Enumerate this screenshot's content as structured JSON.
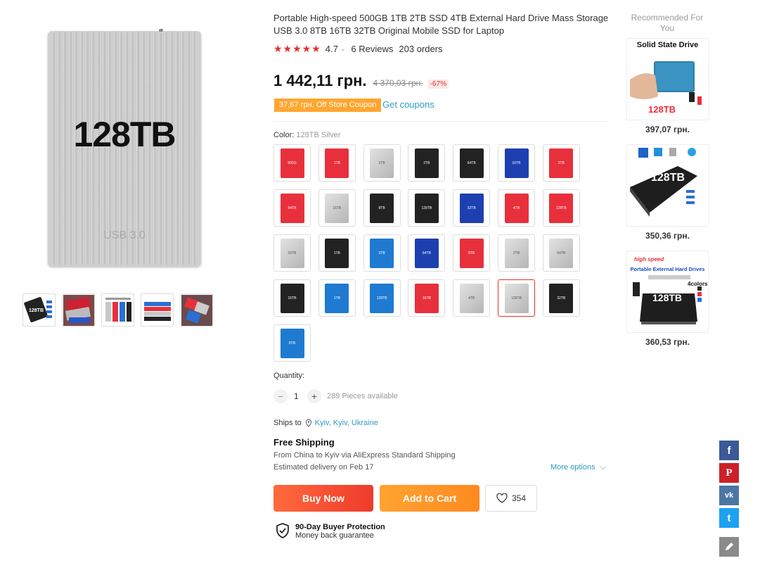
{
  "gallery": {
    "caption": "128TB",
    "usb_text": "USB 3.0",
    "thumb_labels": [
      "128TB"
    ]
  },
  "product": {
    "title": "Portable High-speed 500GB 1TB 2TB SSD 4TB External Hard Drive Mass Storage USB 3.0 8TB 16TB 32TB Original Mobile SSD for Laptop",
    "stars": "★★★★★",
    "rating": "4.7",
    "reviews": "6 Reviews",
    "orders": "203 orders",
    "price": "1 442,11 грн.",
    "old_price": "4 370,03 грн.",
    "discount": "-67%",
    "coupon": "37,67 грн. Off Store Coupon",
    "get_coupons": "Get coupons",
    "color_label": "Color:",
    "color_value": "128TB Silver",
    "swatches": [
      {
        "color": "#e8303c",
        "label": "500G"
      },
      {
        "color": "#e8303c",
        "label": "1TB"
      },
      {
        "color": "#c8c8c8",
        "label": "2TB"
      },
      {
        "color": "#222",
        "label": "2TB"
      },
      {
        "color": "#222",
        "label": "64TB"
      },
      {
        "color": "#1d3fb0",
        "label": "16TB"
      },
      {
        "color": "#e8303c",
        "label": "2TB"
      },
      {
        "color": "#e8303c",
        "label": "64TB"
      },
      {
        "color": "#c8c8c8",
        "label": "16TB"
      },
      {
        "color": "#222",
        "label": "8TB"
      },
      {
        "color": "#222",
        "label": "128TB"
      },
      {
        "color": "#1d3fb0",
        "label": "32TB"
      },
      {
        "color": "#e8303c",
        "label": "4TB"
      },
      {
        "color": "#e8303c",
        "label": "128TB"
      },
      {
        "color": "#c8c8c8",
        "label": "32TB"
      },
      {
        "color": "#222",
        "label": "1TB"
      },
      {
        "color": "#1f7ad1",
        "label": "2TB"
      },
      {
        "color": "#1d3fb0",
        "label": "64TB"
      },
      {
        "color": "#e8303c",
        "label": "8TB"
      },
      {
        "color": "#c8c8c8",
        "label": "2TB"
      },
      {
        "color": "#c8c8c8",
        "label": "64TB"
      },
      {
        "color": "#222",
        "label": "16TB"
      },
      {
        "color": "#1f7ad1",
        "label": "1TB"
      },
      {
        "color": "#1f7ad1",
        "label": "128TB"
      },
      {
        "color": "#e8303c",
        "label": "16TB"
      },
      {
        "color": "#c8c8c8",
        "label": "4TB"
      },
      {
        "color": "#c8c8c8",
        "label": "128TB",
        "selected": true
      },
      {
        "color": "#222",
        "label": "32TB"
      },
      {
        "color": "#1f7ad1",
        "label": "8TB"
      }
    ],
    "quantity_label": "Quantity:",
    "quantity": "1",
    "available": "289 Pieces available",
    "ships_to_label": "Ships to",
    "ships_to": "Kyiv, Kyiv, Ukraine",
    "free_shipping": "Free Shipping",
    "shipping_from": "From China to Kyiv via AliExpress Standard Shipping",
    "estimated": "Estimated delivery on Feb 17",
    "more_options": "More options",
    "buy_now": "Buy Now",
    "add_to_cart": "Add to Cart",
    "wishlist_count": "354",
    "protection_title": "90-Day Buyer Protection",
    "protection_sub": "Money back guarantee"
  },
  "recommended": {
    "heading": "Recommended For You",
    "items": [
      {
        "title": "Solid State Drive",
        "label": "128TB",
        "price": "397,07 грн."
      },
      {
        "title": "",
        "label": "128TB",
        "price": "350,36 грн."
      },
      {
        "title": "high speed",
        "sub": "Portable External Hard Drives",
        "label": "128TB",
        "extra": "4colors",
        "price": "360,53 грн."
      }
    ]
  },
  "share": {
    "facebook": "f",
    "pinterest": "P",
    "vk": "vk",
    "twitter": "t"
  }
}
